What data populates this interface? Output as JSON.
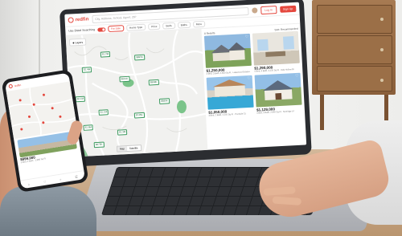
{
  "app": {
    "brand": "redfin",
    "search_placeholder": "City, Address, School, Agent, ZIP",
    "buttons": [
      "Log In",
      "Sign Up"
    ]
  },
  "filters": {
    "toggle_label": "Use Distel Searching",
    "chips": [
      "For Sale",
      "Home Type",
      "Price",
      "Beds",
      "Baths",
      "More"
    ]
  },
  "map": {
    "layers_label": "Layers",
    "price_tags": [
      "$1.2M",
      "$895K",
      "$1.4M",
      "$610K",
      "$2.1M",
      "$999K",
      "$1.1M",
      "$745K",
      "$1.6M",
      "$880K",
      "$1.3M",
      "$675K"
    ],
    "views": [
      "Map",
      "Satellite"
    ]
  },
  "listings": {
    "count_label": "8 Results",
    "sort_label": "Sort: Recommended",
    "cards": [
      {
        "price": "$1,250,000",
        "desc": "4 Bed, 3 Bath, 2,850 Sq Ft · Lakewood Estates"
      },
      {
        "price": "$1,290,000",
        "desc": "5 Bed, 4 Bath, 3,120 Sq Ft · Oak Hollow Dr"
      },
      {
        "price": "$1,050,000",
        "desc": "3 Bed, 2 Bath, 2,210 Sq Ft · Poolside Ct"
      },
      {
        "price": "$1,129,000",
        "desc": "4 Bed, 3 Bath, 2,640 Sq Ft · Sunridge Ln"
      }
    ]
  },
  "phone": {
    "brand": "redfin",
    "card_price": "$899,000",
    "card_desc": "3 Bed, 2 Bath · 1,980 Sq Ft",
    "nav_icons": [
      "⌂",
      "♡",
      "⌕",
      "☰"
    ]
  },
  "colors": {
    "accent": "#e4473d",
    "map_green": "#3c9a5f"
  }
}
